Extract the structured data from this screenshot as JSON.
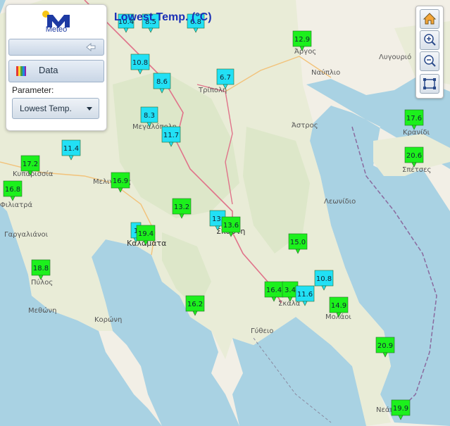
{
  "title": "Lowest Temp. (°C)",
  "panel": {
    "logo_text": "Meteo",
    "data_button": "Data",
    "parameter_label": "Parameter:",
    "parameter_value": "Lowest Temp."
  },
  "tools": [
    "home-icon",
    "zoom-in-icon",
    "zoom-out-icon",
    "extent-icon"
  ],
  "colors": {
    "low": "#22e0f5",
    "high": "#1cf01c",
    "sea": "#a9d2e3",
    "land": "#f2efe6",
    "road": "#e0738a",
    "title": "#1a2fb5"
  },
  "places": [
    {
      "name": "Άργος"
    },
    {
      "name": "Ναύπλιο"
    },
    {
      "name": "Λυγουριό"
    },
    {
      "name": "Τρίπολη"
    },
    {
      "name": "Μεγαλόπολη"
    },
    {
      "name": "Άστρος"
    },
    {
      "name": "Κρανίδι"
    },
    {
      "name": "Σπέτσες"
    },
    {
      "name": "Κυπαρισσία"
    },
    {
      "name": "Φιλιατρά"
    },
    {
      "name": "Μελιγαλάς"
    },
    {
      "name": "Γαργαλιάνοι"
    },
    {
      "name": "Καλαμάτα"
    },
    {
      "name": "Σπάρτη"
    },
    {
      "name": "Λεωνίδιο"
    },
    {
      "name": "Πύλος"
    },
    {
      "name": "Μεθώνη"
    },
    {
      "name": "Κορώνη"
    },
    {
      "name": "Σκάλα"
    },
    {
      "name": "Μολάοι"
    },
    {
      "name": "Γύθειο"
    },
    {
      "name": "Νεάπολη"
    }
  ],
  "stations": [
    {
      "v": "10.4",
      "t": "low"
    },
    {
      "v": "8.5",
      "t": "low"
    },
    {
      "v": "6.8",
      "t": "low"
    },
    {
      "v": "12.9",
      "t": "high"
    },
    {
      "v": "10.8",
      "t": "low"
    },
    {
      "v": "8.6",
      "t": "low"
    },
    {
      "v": "6.7",
      "t": "low"
    },
    {
      "v": "8.3",
      "t": "low"
    },
    {
      "v": "11.7",
      "t": "low"
    },
    {
      "v": "11.4",
      "t": "low"
    },
    {
      "v": "17.2",
      "t": "high"
    },
    {
      "v": "16.8",
      "t": "high"
    },
    {
      "v": "16.9",
      "t": "high"
    },
    {
      "v": "13.2",
      "t": "high"
    },
    {
      "v": "13.",
      "t": "low"
    },
    {
      "v": "13.6",
      "t": "high"
    },
    {
      "v": "1",
      "t": "low"
    },
    {
      "v": "19.4",
      "t": "high"
    },
    {
      "v": "15.0",
      "t": "high"
    },
    {
      "v": "18.8",
      "t": "high"
    },
    {
      "v": "10.8",
      "t": "low"
    },
    {
      "v": "16.4",
      "t": "high"
    },
    {
      "v": "3.4",
      "t": "high"
    },
    {
      "v": "11.6",
      "t": "low"
    },
    {
      "v": "14.9",
      "t": "high"
    },
    {
      "v": "16.2",
      "t": "high"
    },
    {
      "v": "17.6",
      "t": "high"
    },
    {
      "v": "20.6",
      "t": "high"
    },
    {
      "v": "20.9",
      "t": "high"
    },
    {
      "v": "19.9",
      "t": "high"
    }
  ]
}
